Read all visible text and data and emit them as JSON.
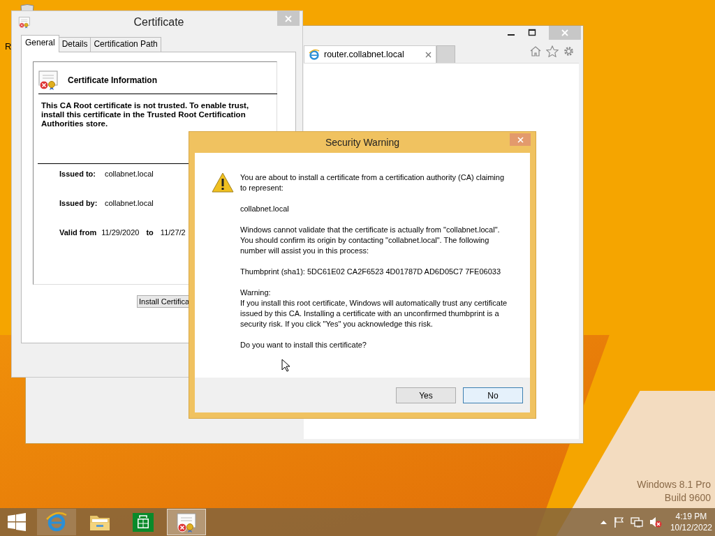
{
  "desktop": {
    "icon_label": "R",
    "os_watermark": [
      "Windows 8.1 Pro",
      "Build 9600"
    ]
  },
  "browser": {
    "tabs": [
      {
        "label": "router.collabnet.local",
        "selected": true
      }
    ]
  },
  "certificate_window": {
    "title": "Certificate",
    "tabs": [
      {
        "label": "General",
        "selected": true
      },
      {
        "label": "Details",
        "selected": false
      },
      {
        "label": "Certification Path",
        "selected": false
      }
    ],
    "heading": "Certificate Information",
    "message": "This CA Root certificate is not trusted. To enable trust, install this certificate in the Trusted Root Certification Authorities store.",
    "fields": [
      {
        "label": "Issued to:",
        "value": "collabnet.local"
      },
      {
        "label": "Issued by:",
        "value": "collabnet.local"
      }
    ],
    "validity": {
      "label": "Valid from",
      "from": "11/29/2020",
      "to_label": "to",
      "to": "11/27/2"
    },
    "install_button": "Install Certifica"
  },
  "security_warning": {
    "title": "Security Warning",
    "paragraphs": [
      [
        "You are about to install a certificate from a certification authority (CA) claiming to represent:"
      ],
      [
        "collabnet.local"
      ],
      [
        "Windows cannot validate that the certificate is actually from \"collabnet.local\". You should confirm its origin by contacting \"collabnet.local\". The following number will assist you in this process:"
      ],
      [
        "Thumbprint (sha1): 5DC61E02 CA2F6523 4D01787D AD6D05C7 7FE06033"
      ],
      [
        "Warning:",
        "If you install this root certificate, Windows will automatically trust any certificate issued by this CA. Installing a certificate with an unconfirmed thumbprint is a security risk. If you click \"Yes\" you acknowledge this risk."
      ],
      [
        "Do you want to install this certificate?"
      ]
    ],
    "buttons": [
      {
        "label": "Yes",
        "selected": false
      },
      {
        "label": "No",
        "selected": true
      }
    ]
  },
  "taskbar": {
    "apps": [
      {
        "kind": "browser",
        "active": false,
        "running": true
      },
      {
        "kind": "folder",
        "active": false,
        "running": false
      },
      {
        "kind": "store",
        "active": false,
        "running": false
      },
      {
        "kind": "certificate",
        "active": true,
        "running": true
      }
    ],
    "clock": {
      "time": "4:19 PM",
      "date": "10/12/2022"
    }
  }
}
